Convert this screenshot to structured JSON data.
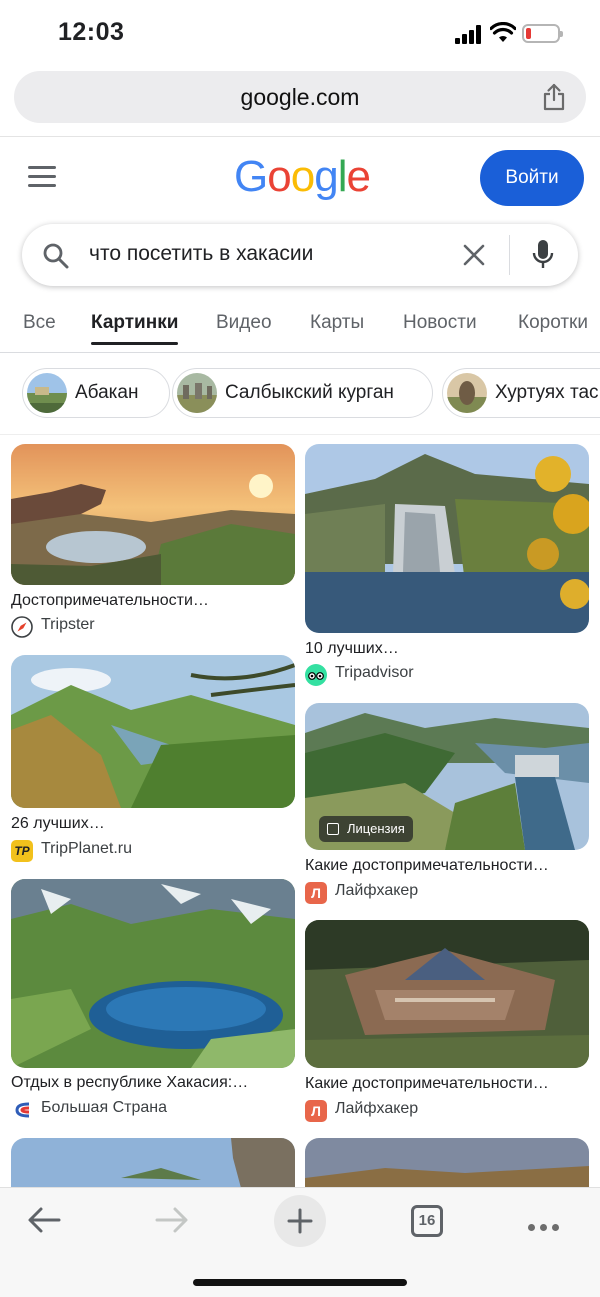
{
  "status": {
    "time": "12:03",
    "battery_level": 0.15,
    "battery_color": "#e53935"
  },
  "browser": {
    "url": "google.com",
    "open_tabs_count": "16"
  },
  "header": {
    "logo": [
      {
        "ch": "G",
        "color": "#4285F4"
      },
      {
        "ch": "o",
        "color": "#EA4335"
      },
      {
        "ch": "o",
        "color": "#FBBC05"
      },
      {
        "ch": "g",
        "color": "#4285F4"
      },
      {
        "ch": "l",
        "color": "#34A853"
      },
      {
        "ch": "e",
        "color": "#EA4335"
      }
    ],
    "signin_label": "Войти",
    "signin_color": "#1a5fd8"
  },
  "search": {
    "query": "что посетить в хакасии"
  },
  "tabs": [
    {
      "label": "Все",
      "active": false
    },
    {
      "label": "Картинки",
      "active": true
    },
    {
      "label": "Видео",
      "active": false
    },
    {
      "label": "Карты",
      "active": false
    },
    {
      "label": "Новости",
      "active": false
    },
    {
      "label": "Коротки",
      "active": false
    }
  ],
  "chips": [
    {
      "label": "Абакан"
    },
    {
      "label": "Салбыкский курган"
    },
    {
      "label": "Хуртуях тас"
    }
  ],
  "results": {
    "left": [
      {
        "title": "Достопримечательности…",
        "source": "Tripster",
        "favicon": "compass-icon"
      },
      {
        "title": "26 лучших…",
        "source": "TripPlanet.ru",
        "favicon": "tp-icon"
      },
      {
        "title": "Отдых в республике Хакасия:…",
        "source": "Большая Страна",
        "favicon": "bolshaya-strana-icon"
      }
    ],
    "right": [
      {
        "title": "10 лучших…",
        "source": "Tripadvisor",
        "favicon": "owl-icon"
      },
      {
        "title": "Какие достопримечательности…",
        "source": "Лайфхакер",
        "favicon": "lifehacker-icon",
        "badge": "Лицензия"
      },
      {
        "title": "Какие достопримечательности…",
        "source": "Лайфхакер",
        "favicon": "lifehacker-icon"
      }
    ]
  }
}
